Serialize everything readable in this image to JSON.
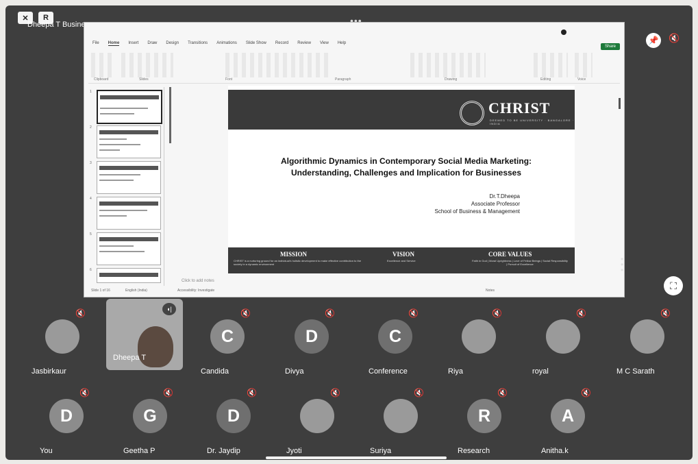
{
  "topbar": {
    "dots": "•••",
    "icon1": "camera-off-icon",
    "icon2_label": "R"
  },
  "share": {
    "title": "Dheepa T Business"
  },
  "screen": {
    "tabs": [
      "File",
      "Home",
      "Insert",
      "Draw",
      "Design",
      "Transitions",
      "Animations",
      "Slide Show",
      "Record",
      "Review",
      "View",
      "Help"
    ],
    "share_label": "Share",
    "ribbon_labels": [
      "Clipboard",
      "Slides",
      "Font",
      "Paragraph",
      "Drawing",
      "Editing",
      "Voice"
    ],
    "thumb_numbers": [
      "1",
      "2",
      "3",
      "4",
      "5",
      "6"
    ],
    "notes": "Click to add notes",
    "status": {
      "slide": "Slide 1 of 16",
      "lang": "English (India)",
      "access": "Accessibility: Investigate",
      "notes_btn": "Notes"
    }
  },
  "slide": {
    "logo": "CHRIST",
    "logo_sub": "DEEMED TO BE UNIVERSITY · BANGALORE · INDIA",
    "title_line1": "Algorithmic Dynamics in Contemporary Social Media Marketing:",
    "title_line2": "Understanding, Challenges and Implication for Businesses",
    "author_name": "Dr.T.Dheepa",
    "author_role": "Associate Professor",
    "author_school": "School of Business & Management",
    "footer": {
      "mission": "MISSION",
      "mission_text": "CHRIST is a nurturing ground for an individual's holistic development to make effective contribution to the society in a dynamic environment",
      "vision": "VISION",
      "vision_text": "Excellence and Service",
      "values": "CORE  VALUES",
      "values_text": "Faith in God | Moral Uprightness | Love of Fellow Beings | Social Responsibility | Pursuit of Excellence"
    }
  },
  "participants_row1": [
    {
      "name": "Jasbirkaur",
      "initial": "",
      "photo": true
    },
    {
      "name": "Dheepa T",
      "initial": "",
      "photo": true,
      "speaking": true
    },
    {
      "name": "Candida",
      "initial": "C",
      "color": "#8a8a8a"
    },
    {
      "name": "Divya",
      "initial": "D",
      "color": "#6f6f6f"
    },
    {
      "name": "Conference",
      "initial": "C",
      "color": "#6f6f6f"
    },
    {
      "name": "Riya",
      "initial": "",
      "photo": true
    },
    {
      "name": "royal",
      "initial": "",
      "photo": true
    },
    {
      "name": "M C Sarath",
      "initial": "",
      "photo": true
    }
  ],
  "participants_row2": [
    {
      "name": "You",
      "initial": "D",
      "color": "#8c8c8c"
    },
    {
      "name": "Geetha P",
      "initial": "G",
      "color": "#7a7a7a"
    },
    {
      "name": "Dr. Jaydip",
      "initial": "D",
      "color": "#6f6f6f"
    },
    {
      "name": "Jyoti",
      "initial": "",
      "photo": true
    },
    {
      "name": "Suriya",
      "initial": "",
      "photo": true
    },
    {
      "name": "Research",
      "initial": "R",
      "color": "#7e7e7e"
    },
    {
      "name": "Anitha.k",
      "initial": "A",
      "color": "#8c8c8c"
    }
  ]
}
